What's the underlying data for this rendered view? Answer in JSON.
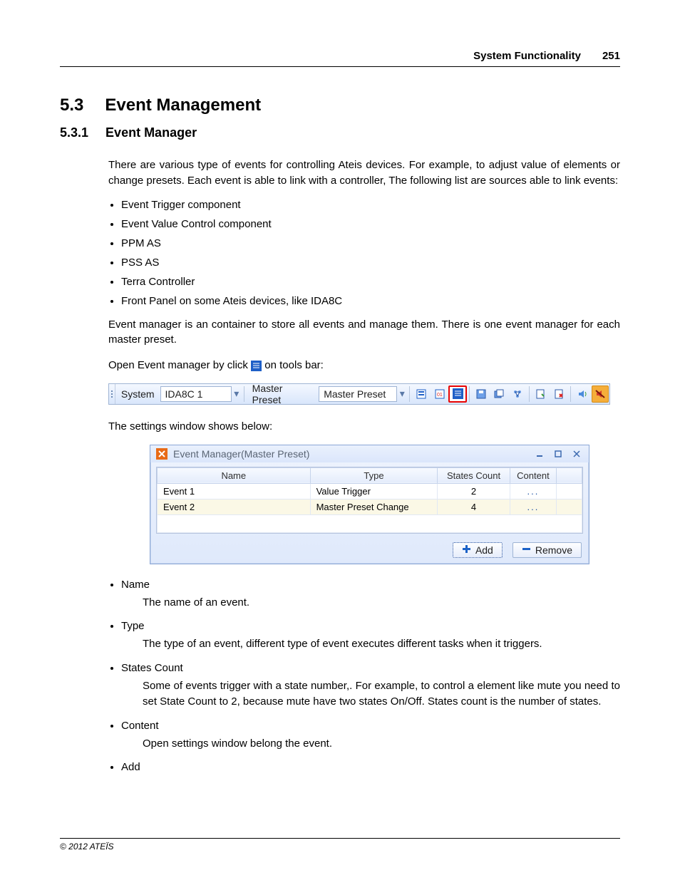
{
  "header": {
    "chapter": "System Functionality",
    "page": "251"
  },
  "section": {
    "num": "5.3",
    "title": "Event Management"
  },
  "subsection": {
    "num": "5.3.1",
    "title": "Event Manager"
  },
  "para_intro": "There are various type of events for controlling Ateis devices.  For example, to adjust value of elements or change presets. Each event is able to link with a controller, The following list are sources able to link events:",
  "source_list": [
    "Event Trigger component",
    "Event Value Control component",
    "PPM AS",
    "PSS AS",
    "Terra Controller",
    "Front Panel on some Ateis devices, like IDA8C"
  ],
  "para_container": "Event manager is an container to store all events and manage them. There is one event manager for each master preset.",
  "para_open_pre": "Open Event manager by click ",
  "para_open_post": " on tools bar:",
  "toolbar": {
    "system_label": "System",
    "system_value": "IDA8C 1",
    "master_label": "Master Preset",
    "master_value": "Master Preset"
  },
  "para_settings": "The settings window shows below:",
  "window": {
    "title": "Event Manager(Master Preset)",
    "columns": {
      "name": "Name",
      "type": "Type",
      "states": "States Count",
      "content": "Content"
    },
    "rows": [
      {
        "name": "Event 1",
        "type": "Value Trigger",
        "states": "2",
        "content": "..."
      },
      {
        "name": "Event 2",
        "type": "Master Preset Change",
        "states": "4",
        "content": "..."
      }
    ],
    "add_label": "Add",
    "remove_label": "Remove"
  },
  "field_docs": {
    "name_term": "Name",
    "name_desc": "The name of an event.",
    "type_term": "Type",
    "type_desc": "The type of an event, different type of event executes different tasks when it triggers.",
    "states_term": "States Count",
    "states_desc": "Some of events trigger with a state number,. For example, to control a element like mute you need to set State Count to 2, because mute have two states On/Off. States count is the number of states.",
    "content_term": "Content",
    "content_desc": "Open settings window belong the event.",
    "add_term": "Add"
  },
  "footer": "© 2012 ATEÏS"
}
